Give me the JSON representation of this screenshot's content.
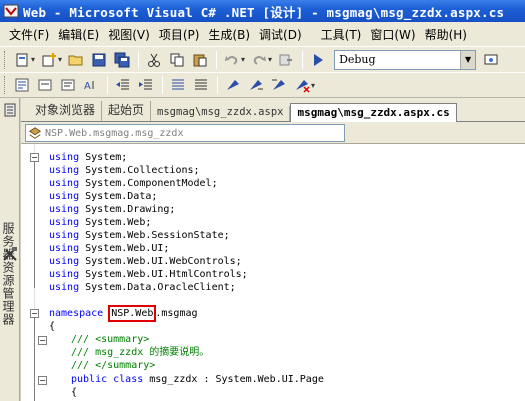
{
  "window": {
    "title": "Web - Microsoft Visual C# .NET [设计] - msgmag\\msg_zzdx.aspx.cs"
  },
  "menu": {
    "items": [
      {
        "label": "文件(F)"
      },
      {
        "label": "编辑(E)"
      },
      {
        "label": "视图(V)"
      },
      {
        "label": "项目(P)"
      },
      {
        "label": "生成(B)"
      },
      {
        "label": "调试(D)"
      },
      {
        "label": "工具(T)"
      },
      {
        "label": "窗口(W)"
      },
      {
        "label": "帮助(H)"
      }
    ]
  },
  "toolbar": {
    "configuration": "Debug"
  },
  "left_dock": {
    "panel_label": "服务器资源管理器"
  },
  "tabs": [
    {
      "label": "对象浏览器"
    },
    {
      "label": "起始页"
    },
    {
      "label": "msgmag\\msg_zzdx.aspx"
    },
    {
      "label": "msgmag\\msg_zzdx.aspx.cs"
    }
  ],
  "nav": {
    "type_selector": "NSP.Web.msgmag.msg_zzdx"
  },
  "code": {
    "using_lines": [
      {
        "kw": "using",
        "ns": "System;"
      },
      {
        "kw": "using",
        "ns": "System.Collections;"
      },
      {
        "kw": "using",
        "ns": "System.ComponentModel;"
      },
      {
        "kw": "using",
        "ns": "System.Data;"
      },
      {
        "kw": "using",
        "ns": "System.Drawing;"
      },
      {
        "kw": "using",
        "ns": "System.Web;"
      },
      {
        "kw": "using",
        "ns": "System.Web.SessionState;"
      },
      {
        "kw": "using",
        "ns": "System.Web.UI;"
      },
      {
        "kw": "using",
        "ns": "System.Web.UI.WebControls;"
      },
      {
        "kw": "using",
        "ns": "System.Web.UI.HtmlControls;"
      },
      {
        "kw": "using",
        "ns": "System.Data.OracleClient;"
      }
    ],
    "namespace_kw": "namespace",
    "namespace_highlight": "NSP.Web",
    "namespace_rest": ".msgmag",
    "open_brace": "{",
    "summary_open": "/// <summary>",
    "summary_text": "/// msg_zzdx 的摘要说明。",
    "summary_close": "/// </summary>",
    "class_kw": "public class",
    "class_decl": " msg_zzdx : System.Web.UI.Page",
    "class_brace": "{"
  },
  "colors": {
    "keyword": "#0000ff",
    "comment": "#008000",
    "highlight_box": "#e00000",
    "titlebar": "#1d5fd6"
  }
}
